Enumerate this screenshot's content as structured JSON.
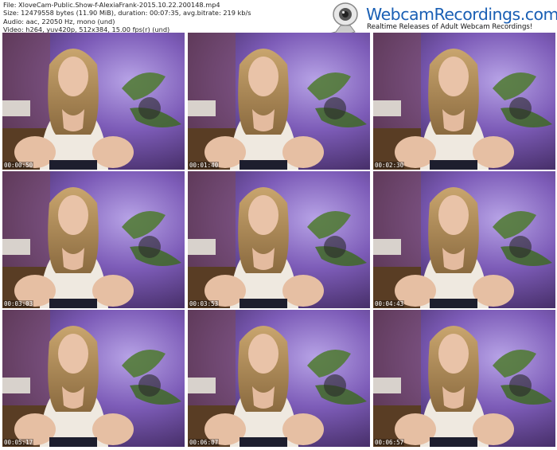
{
  "file_info": {
    "file": "File: XloveCam-Public.Show-f-AlexiaFrank-2015.10.22.200148.mp4",
    "size": "Size: 12479558 bytes (11.90 MiB), duration: 00:07:35, avg.bitrate: 219 kb/s",
    "audio": "Audio: aac, 22050 Hz, mono (und)",
    "video": "Video: h264, yuv420p, 512x384, 15.00 fps(r) (und)"
  },
  "logo": {
    "brand": "WebcamRecordings.com",
    "tagline": "Realtime Releases of Adult Webcam Recordings!",
    "icon": "webcam-icon"
  },
  "thumbnails": [
    {
      "timestamp": "00:00:50"
    },
    {
      "timestamp": "00:01:40"
    },
    {
      "timestamp": "00:02:30"
    },
    {
      "timestamp": "00:03:03"
    },
    {
      "timestamp": "00:03:53"
    },
    {
      "timestamp": "00:04:43"
    },
    {
      "timestamp": "00:05:17"
    },
    {
      "timestamp": "00:06:07"
    },
    {
      "timestamp": "00:06:57"
    }
  ],
  "colors": {
    "brand_blue": "#1a5fb4",
    "backdrop_purple": "#6b4a8c",
    "timestamp_text": "#ffffff"
  }
}
